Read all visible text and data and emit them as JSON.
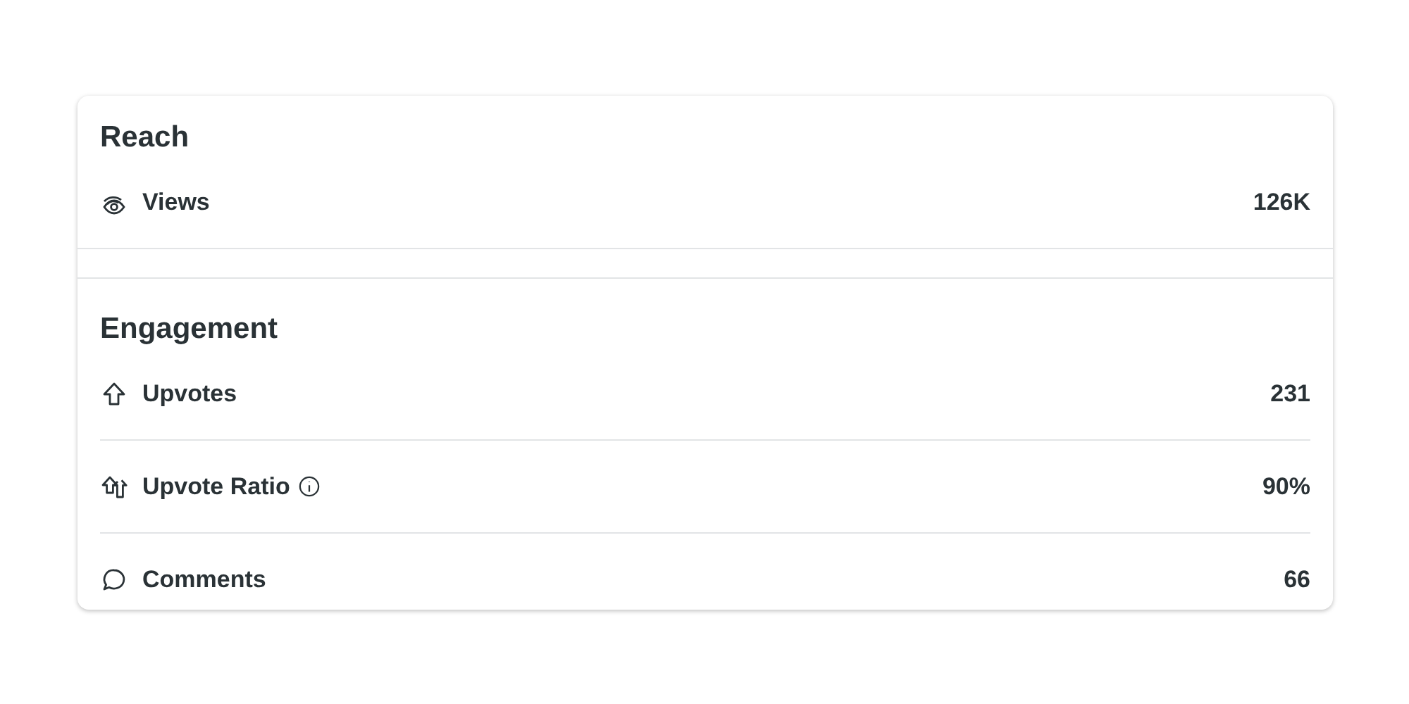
{
  "sections": [
    {
      "title": "Reach",
      "metrics": [
        {
          "kind": "views",
          "label": "Views",
          "info": false,
          "value": "126K"
        }
      ]
    },
    {
      "title": "Engagement",
      "metrics": [
        {
          "kind": "upvotes",
          "label": "Upvotes",
          "info": false,
          "value": "231"
        },
        {
          "kind": "ratio",
          "label": "Upvote Ratio",
          "info": true,
          "value": "90%"
        },
        {
          "kind": "comments",
          "label": "Comments",
          "info": false,
          "value": "66"
        }
      ]
    }
  ]
}
